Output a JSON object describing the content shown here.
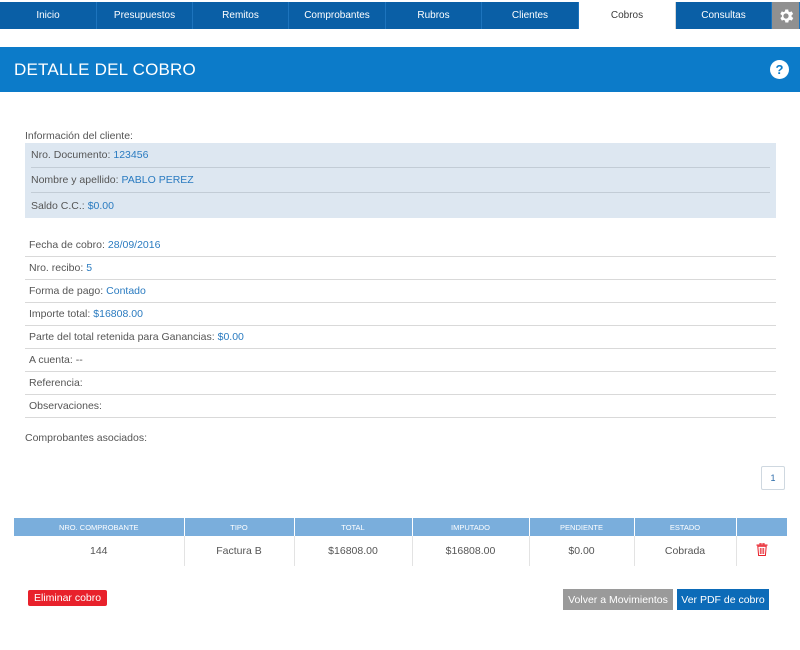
{
  "nav": {
    "tabs": [
      {
        "label": "Inicio"
      },
      {
        "label": "Presupuestos"
      },
      {
        "label": "Remitos"
      },
      {
        "label": "Comprobantes"
      },
      {
        "label": "Rubros"
      },
      {
        "label": "Clientes"
      },
      {
        "label": "Cobros"
      },
      {
        "label": "Consultas"
      }
    ],
    "active_tab": "Cobros",
    "settings_icon": "gear-icon"
  },
  "header": {
    "title": "DETALLE DEL COBRO",
    "help_label": "?"
  },
  "client": {
    "section_label": "Información del cliente:",
    "rows": [
      {
        "label": "Nro. Documento:",
        "value": "123456"
      },
      {
        "label": "Nombre y apellido:",
        "value": "PABLO PEREZ"
      },
      {
        "label": "Saldo C.C.:",
        "value": "$0.00"
      }
    ]
  },
  "details": [
    {
      "label": "Fecha de cobro:",
      "value": "28/09/2016"
    },
    {
      "label": "Nro. recibo:",
      "value": "5"
    },
    {
      "label": "Forma de pago:",
      "value": "Contado"
    },
    {
      "label": "Importe total:",
      "value": "$16808.00"
    },
    {
      "label": "Parte del total retenida para Ganancias:",
      "value": "$0.00"
    },
    {
      "label": "A cuenta:",
      "value": "--"
    },
    {
      "label": "Referencia:",
      "value": ""
    },
    {
      "label": "Observaciones:",
      "value": ""
    }
  ],
  "comprobantes": {
    "section_label": "Comprobantes asociados:",
    "page": "1",
    "columns": [
      "NRO. COMPROBANTE",
      "TIPO",
      "TOTAL",
      "IMPUTADO",
      "PENDIENTE",
      "ESTADO",
      ""
    ],
    "rows": [
      {
        "nro": "144",
        "tipo": "Factura B",
        "total": "$16808.00",
        "imputado": "$16808.00",
        "pendiente": "$0.00",
        "estado": "Cobrada"
      }
    ]
  },
  "actions": {
    "delete_label": "Eliminar cobro",
    "back_label": "Volver a Movimientos",
    "pdf_label": "Ver PDF de cobro"
  },
  "colors": {
    "nav_blue": "#0a5fa6",
    "header_blue": "#0c7bc9",
    "value_blue": "#2a7bc0",
    "danger_red": "#e8212b",
    "table_header": "#7aaedc"
  }
}
